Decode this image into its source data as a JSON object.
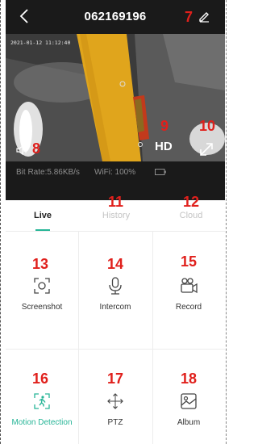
{
  "header": {
    "title": "062169196",
    "edit_badge": "7"
  },
  "video": {
    "timestamp": "2021-01-12 11:12:40",
    "hd_label": "HD",
    "badges": {
      "speaker": "8",
      "hd": "9",
      "fullscreen": "10"
    }
  },
  "status": {
    "bitrate": "Bit Rate:5.86KB/s",
    "wifi": "WiFi: 100%"
  },
  "tabs": [
    {
      "label": "Live",
      "active": true
    },
    {
      "label": "History",
      "badge": "11"
    },
    {
      "label": "Cloud",
      "badge": "12"
    }
  ],
  "actions": [
    {
      "label": "Screenshot",
      "icon": "camera-screenshot-icon",
      "badge": "13"
    },
    {
      "label": "Intercom",
      "icon": "microphone-icon",
      "badge": "14"
    },
    {
      "label": "Record",
      "icon": "video-record-icon",
      "badge": "15"
    },
    {
      "label": "Motion Detection",
      "icon": "running-person-icon",
      "badge": "16"
    },
    {
      "label": "PTZ",
      "icon": "move-arrows-icon",
      "badge": "17"
    },
    {
      "label": "Album",
      "icon": "image-album-icon",
      "badge": "18"
    }
  ],
  "colors": {
    "accent": "#27b597",
    "badge": "#e0201c",
    "header_bg": "#1a1a1a"
  }
}
